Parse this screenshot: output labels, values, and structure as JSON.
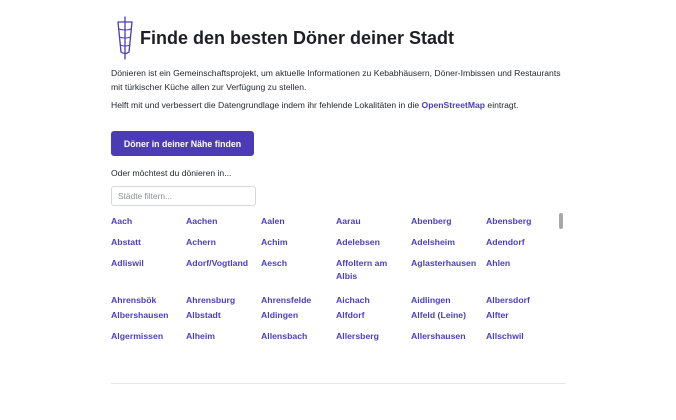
{
  "header": {
    "logo_icon": "doner-skewer-icon",
    "title": "Finde den besten Döner deiner Stadt"
  },
  "intro": {
    "text": "Dönieren ist ein Gemeinschaftsprojekt, um aktuelle Informationen zu Kebabhäusern, Döner-Imbissen und Restaurants mit türkischer Küche allen zur Verfügung zu stellen."
  },
  "help": {
    "before": "Helft mit und verbessert die Datengrundlage indem ihr fehlende Lokalitäten in die ",
    "link_label": "OpenStreetMap",
    "after": " eintragt."
  },
  "actions": {
    "near_button_label": "Döner in deiner Nähe finden",
    "or_label": "Oder möchtest du dönieren in..."
  },
  "filter": {
    "placeholder": "Städte filtern...",
    "value": ""
  },
  "cities": [
    "Aach",
    "Aachen",
    "Aalen",
    "Aarau",
    "Abenberg",
    "Abensberg",
    "Abstatt",
    "Achern",
    "Achim",
    "Adelebsen",
    "Adelsheim",
    "Adendorf",
    "Adliswil",
    "Adorf/Vogtland",
    "Aesch",
    "Affoltern am Albis",
    "Aglasterhausen",
    "Ahlen",
    "Ahrensbök",
    "Ahrensburg",
    "Ahrensfelde",
    "Aichach",
    "Aidlingen",
    "Albersdorf",
    "Albershausen",
    "Albstadt",
    "Aldingen",
    "Alfdorf",
    "Alfeld (Leine)",
    "Alfter",
    "Algermissen",
    "Alheim",
    "Allensbach",
    "Allersberg",
    "Allershausen",
    "Allschwil"
  ],
  "colors": {
    "accent": "#4b3cb5",
    "link": "#4a3fbf"
  }
}
